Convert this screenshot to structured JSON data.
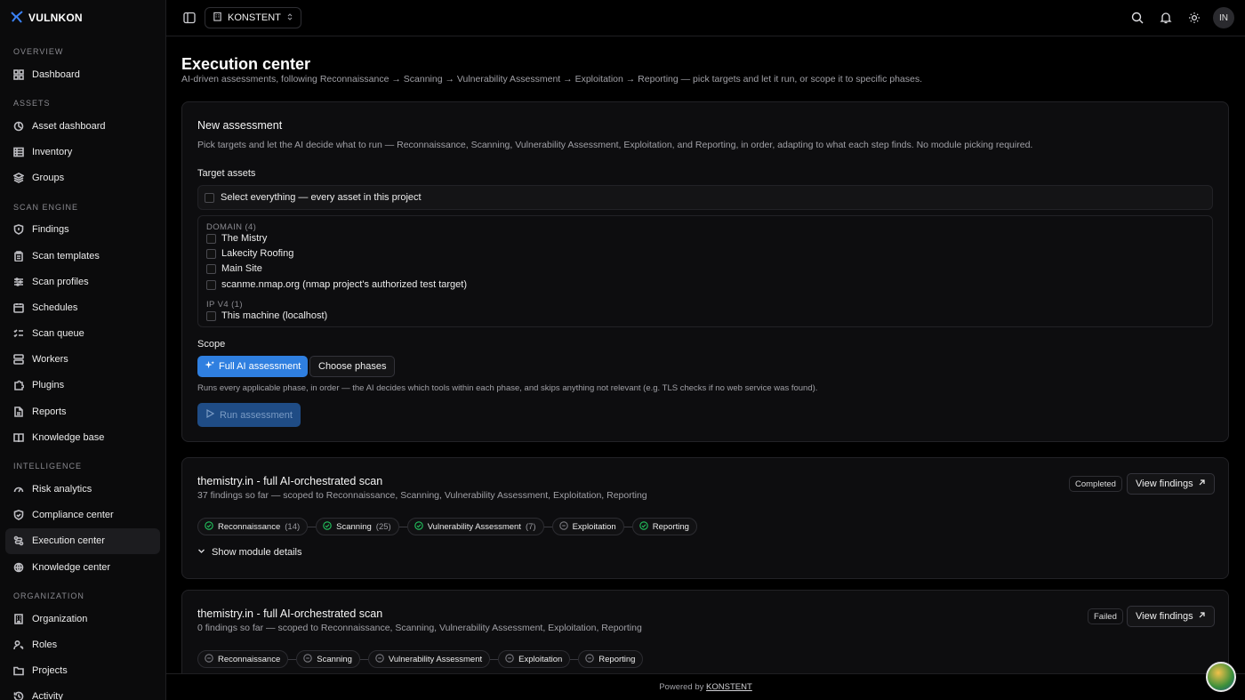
{
  "brand": {
    "name": "VULNKON"
  },
  "sidebar": {
    "sections": [
      {
        "label": "OVERVIEW",
        "items": [
          {
            "label": "Dashboard",
            "icon": "dashboard-icon"
          }
        ]
      },
      {
        "label": "ASSETS",
        "items": [
          {
            "label": "Asset dashboard",
            "icon": "asset-dashboard-icon"
          },
          {
            "label": "Inventory",
            "icon": "inventory-icon"
          },
          {
            "label": "Groups",
            "icon": "groups-icon"
          }
        ]
      },
      {
        "label": "SCAN ENGINE",
        "items": [
          {
            "label": "Findings",
            "icon": "shield-icon"
          },
          {
            "label": "Scan templates",
            "icon": "clipboard-icon"
          },
          {
            "label": "Scan profiles",
            "icon": "sliders-icon"
          },
          {
            "label": "Schedules",
            "icon": "calendar-icon"
          },
          {
            "label": "Scan queue",
            "icon": "list-check-icon"
          },
          {
            "label": "Workers",
            "icon": "server-icon"
          },
          {
            "label": "Plugins",
            "icon": "puzzle-icon"
          },
          {
            "label": "Reports",
            "icon": "file-icon"
          },
          {
            "label": "Knowledge base",
            "icon": "book-icon"
          }
        ]
      },
      {
        "label": "INTELLIGENCE",
        "items": [
          {
            "label": "Risk analytics",
            "icon": "gauge-icon"
          },
          {
            "label": "Compliance center",
            "icon": "shield-check-icon"
          },
          {
            "label": "Execution center",
            "icon": "route-icon",
            "active": true
          },
          {
            "label": "Knowledge center",
            "icon": "globe-icon"
          }
        ]
      },
      {
        "label": "ORGANIZATION",
        "items": [
          {
            "label": "Organization",
            "icon": "building-icon"
          },
          {
            "label": "Roles",
            "icon": "user-key-icon"
          },
          {
            "label": "Projects",
            "icon": "folder-icon"
          },
          {
            "label": "Activity",
            "icon": "history-icon"
          }
        ]
      }
    ]
  },
  "topbar": {
    "workspace": "KONSTENT",
    "avatar": "IN"
  },
  "page": {
    "title": "Execution center",
    "subtitle": "AI-driven assessments, following Reconnaissance → Scanning → Vulnerability Assessment → Exploitation → Reporting — pick targets and let it run, or scope it to specific phases."
  },
  "new_assessment": {
    "title": "New assessment",
    "description": "Pick targets and let the AI decide what to run — Reconnaissance, Scanning, Vulnerability Assessment, Exploitation, and Reporting, in order, adapting to what each step finds. No module picking required.",
    "target_label": "Target assets",
    "select_all": "Select everything — every asset in this project",
    "groups": [
      {
        "label": "DOMAIN (4)",
        "assets": [
          "The Mistry",
          "Lakecity Roofing",
          "Main Site",
          "scanme.nmap.org (nmap project's authorized test target)"
        ]
      },
      {
        "label": "IP V4 (1)",
        "assets": [
          "This machine (localhost)"
        ]
      }
    ],
    "scope_label": "Scope",
    "scope_full": "Full AI assessment",
    "scope_choose": "Choose phases",
    "scope_note": "Runs every applicable phase, in order — the AI decides which tools within each phase, and skips anything not relevant (e.g. TLS checks if no web service was found).",
    "run_label": "Run assessment"
  },
  "runs": [
    {
      "title": "themistry.in - full AI-orchestrated scan",
      "summary": "37 findings so far — scoped to Reconnaissance, Scanning, Vulnerability Assessment, Exploitation, Reporting",
      "status": "Completed",
      "view": "View findings",
      "phases": [
        {
          "name": "Reconnaissance",
          "count": "(14)",
          "state": "done"
        },
        {
          "name": "Scanning",
          "count": "(25)",
          "state": "done"
        },
        {
          "name": "Vulnerability Assessment",
          "count": "(7)",
          "state": "done"
        },
        {
          "name": "Exploitation",
          "count": "",
          "state": "skipped"
        },
        {
          "name": "Reporting",
          "count": "",
          "state": "done"
        }
      ],
      "details": "Show module details"
    },
    {
      "title": "themistry.in - full AI-orchestrated scan",
      "summary": "0 findings so far — scoped to Reconnaissance, Scanning, Vulnerability Assessment, Exploitation, Reporting",
      "status": "Failed",
      "view": "View findings",
      "phases": [
        {
          "name": "Reconnaissance",
          "count": "",
          "state": "skipped"
        },
        {
          "name": "Scanning",
          "count": "",
          "state": "skipped"
        },
        {
          "name": "Vulnerability Assessment",
          "count": "",
          "state": "skipped"
        },
        {
          "name": "Exploitation",
          "count": "",
          "state": "skipped"
        },
        {
          "name": "Reporting",
          "count": "",
          "state": "skipped"
        }
      ]
    }
  ],
  "footer": {
    "prefix": "Powered by",
    "link": "KONSTENT"
  },
  "colors": {
    "accent": "#2f7fe0",
    "success": "#22c55e"
  }
}
